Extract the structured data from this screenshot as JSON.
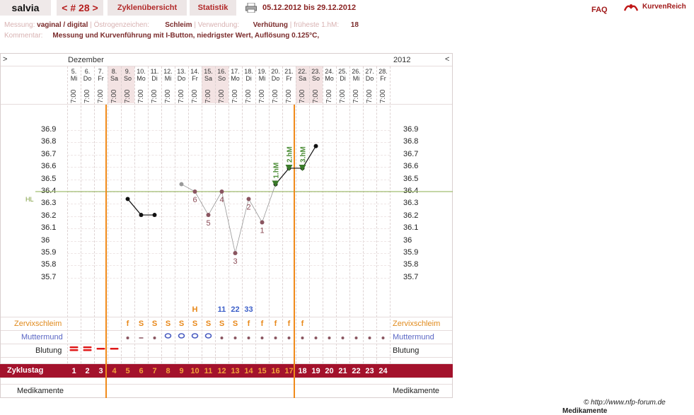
{
  "header": {
    "user": "salvia",
    "cycle_nav": "< # 28 >",
    "tabs": [
      "Zyklenübersicht",
      "Statistik"
    ],
    "date_range": "05.12.2012 bis 29.12.2012",
    "faq": "FAQ",
    "brand": "KurvenReich"
  },
  "info": {
    "messung_label": "Messung:",
    "messung_value": "vaginal / digital",
    "oestrogen_label": "Östrogenzeichen:",
    "oestrogen_value": "Schleim",
    "verwendung_label": "Verwendung:",
    "verwendung_value": "Verhütung",
    "fruehest_label": "früheste 1.hM:",
    "fruehest_value": "18",
    "kommentar_label": "Kommentar:",
    "kommentar_value": "Messung und Kurvenführung mit I-Button, niedrigster Wert, Auflösung 0.125°C,"
  },
  "chart": {
    "nav_left": ">",
    "nav_right": "<",
    "month": "Dezember",
    "year": "2012",
    "hl_label": "HL",
    "footer_credit": "© http://www.nfp-forum.de",
    "footer_cut": "Medikamente",
    "rows": {
      "zervix": "Zervixschleim",
      "mumu": "Muttermund",
      "blutung": "Blutung",
      "zyklustag": "Zyklustag",
      "medikamente": "Medikamente"
    }
  },
  "chart_data": {
    "type": "line",
    "days": [
      "5.",
      "6.",
      "7.",
      "8.",
      "9.",
      "10.",
      "11.",
      "12.",
      "13.",
      "14.",
      "15.",
      "16.",
      "17.",
      "18.",
      "19.",
      "20.",
      "21.",
      "22.",
      "23.",
      "24.",
      "25.",
      "26.",
      "27.",
      "28."
    ],
    "weekdays": [
      "Mi",
      "Do",
      "Fr",
      "Sa",
      "So",
      "Mo",
      "Di",
      "Mi",
      "Do",
      "Fr",
      "Sa",
      "So",
      "Mo",
      "Di",
      "Mi",
      "Do",
      "Fr",
      "Sa",
      "So",
      "Mo",
      "Di",
      "Mi",
      "Do",
      "Fr"
    ],
    "times": [
      "7:00",
      "7:00",
      "7:00",
      "7:00",
      "7:00",
      "7:00",
      "7:00",
      "7:00",
      "7:00",
      "7:00",
      "7:00",
      "7:00",
      "7:00",
      "7:00",
      "7:00",
      "7:00",
      "7:00",
      "7:00",
      "7:00",
      "7:00",
      "7:00",
      "7:00",
      "7:00",
      "7:00"
    ],
    "cycle_days": [
      "1",
      "2",
      "3",
      "4",
      "5",
      "6",
      "7",
      "8",
      "9",
      "10",
      "11",
      "12",
      "13",
      "14",
      "15",
      "16",
      "17",
      "18",
      "19",
      "20",
      "21",
      "22",
      "23",
      "24"
    ],
    "y_ticks": [
      "36.9",
      "36.8",
      "36.7",
      "36.6",
      "36.5",
      "36.4",
      "36.3",
      "36.2",
      "36.1",
      "36",
      "35.9",
      "35.8",
      "35.7"
    ],
    "ylim": [
      35.65,
      37.0
    ],
    "coverline": 36.4,
    "temperatures": [
      null,
      null,
      null,
      null,
      36.34,
      36.21,
      36.21,
      null,
      36.46,
      36.4,
      36.21,
      36.4,
      35.9,
      36.34,
      36.15,
      36.46,
      36.59,
      36.59,
      36.77,
      null,
      null,
      null,
      null,
      null
    ],
    "excluded": [
      false,
      false,
      false,
      false,
      false,
      false,
      false,
      false,
      true,
      true,
      true,
      true,
      true,
      true,
      true,
      false,
      false,
      false,
      false,
      false,
      false,
      false,
      false,
      false
    ],
    "low_labels": [
      {
        "index": 9,
        "text": "6"
      },
      {
        "index": 10,
        "text": "5"
      },
      {
        "index": 11,
        "text": "4"
      },
      {
        "index": 12,
        "text": "3"
      },
      {
        "index": 13,
        "text": "2"
      },
      {
        "index": 14,
        "text": "1"
      }
    ],
    "high_markers": [
      {
        "index": 15,
        "text": "1.hM"
      },
      {
        "index": 16,
        "text": "2.hM"
      },
      {
        "index": 17,
        "text": "3.hM"
      }
    ],
    "zervix": [
      "",
      "",
      "",
      "",
      "f",
      "S",
      "S",
      "S",
      "S",
      "S",
      "S",
      "S",
      "S",
      "f",
      "f",
      "f",
      "f",
      "f",
      "",
      "",
      "",
      "",
      "",
      ""
    ],
    "zervix_top": [
      "",
      "",
      "",
      "",
      "",
      "",
      "",
      "",
      "",
      "H",
      "",
      "11",
      "22",
      "33",
      "",
      "",
      "",
      "",
      "",
      "",
      "",
      "",
      "",
      ""
    ],
    "bleeding": [
      "heavy",
      "heavy",
      "light",
      "light",
      "",
      "",
      "",
      "",
      "",
      "",
      "",
      "",
      "",
      "",
      "",
      "",
      "",
      "",
      "",
      "",
      "",
      "",
      "",
      ""
    ],
    "mumu": [
      "",
      "",
      "",
      "",
      "dot",
      "dash",
      "dot",
      "O",
      "O",
      "O",
      "O",
      "dot",
      "dot",
      "dot",
      "dot",
      "dot",
      "dot",
      "dot",
      "dot",
      "dot",
      "dot",
      "dot",
      "dot",
      "dot"
    ]
  }
}
